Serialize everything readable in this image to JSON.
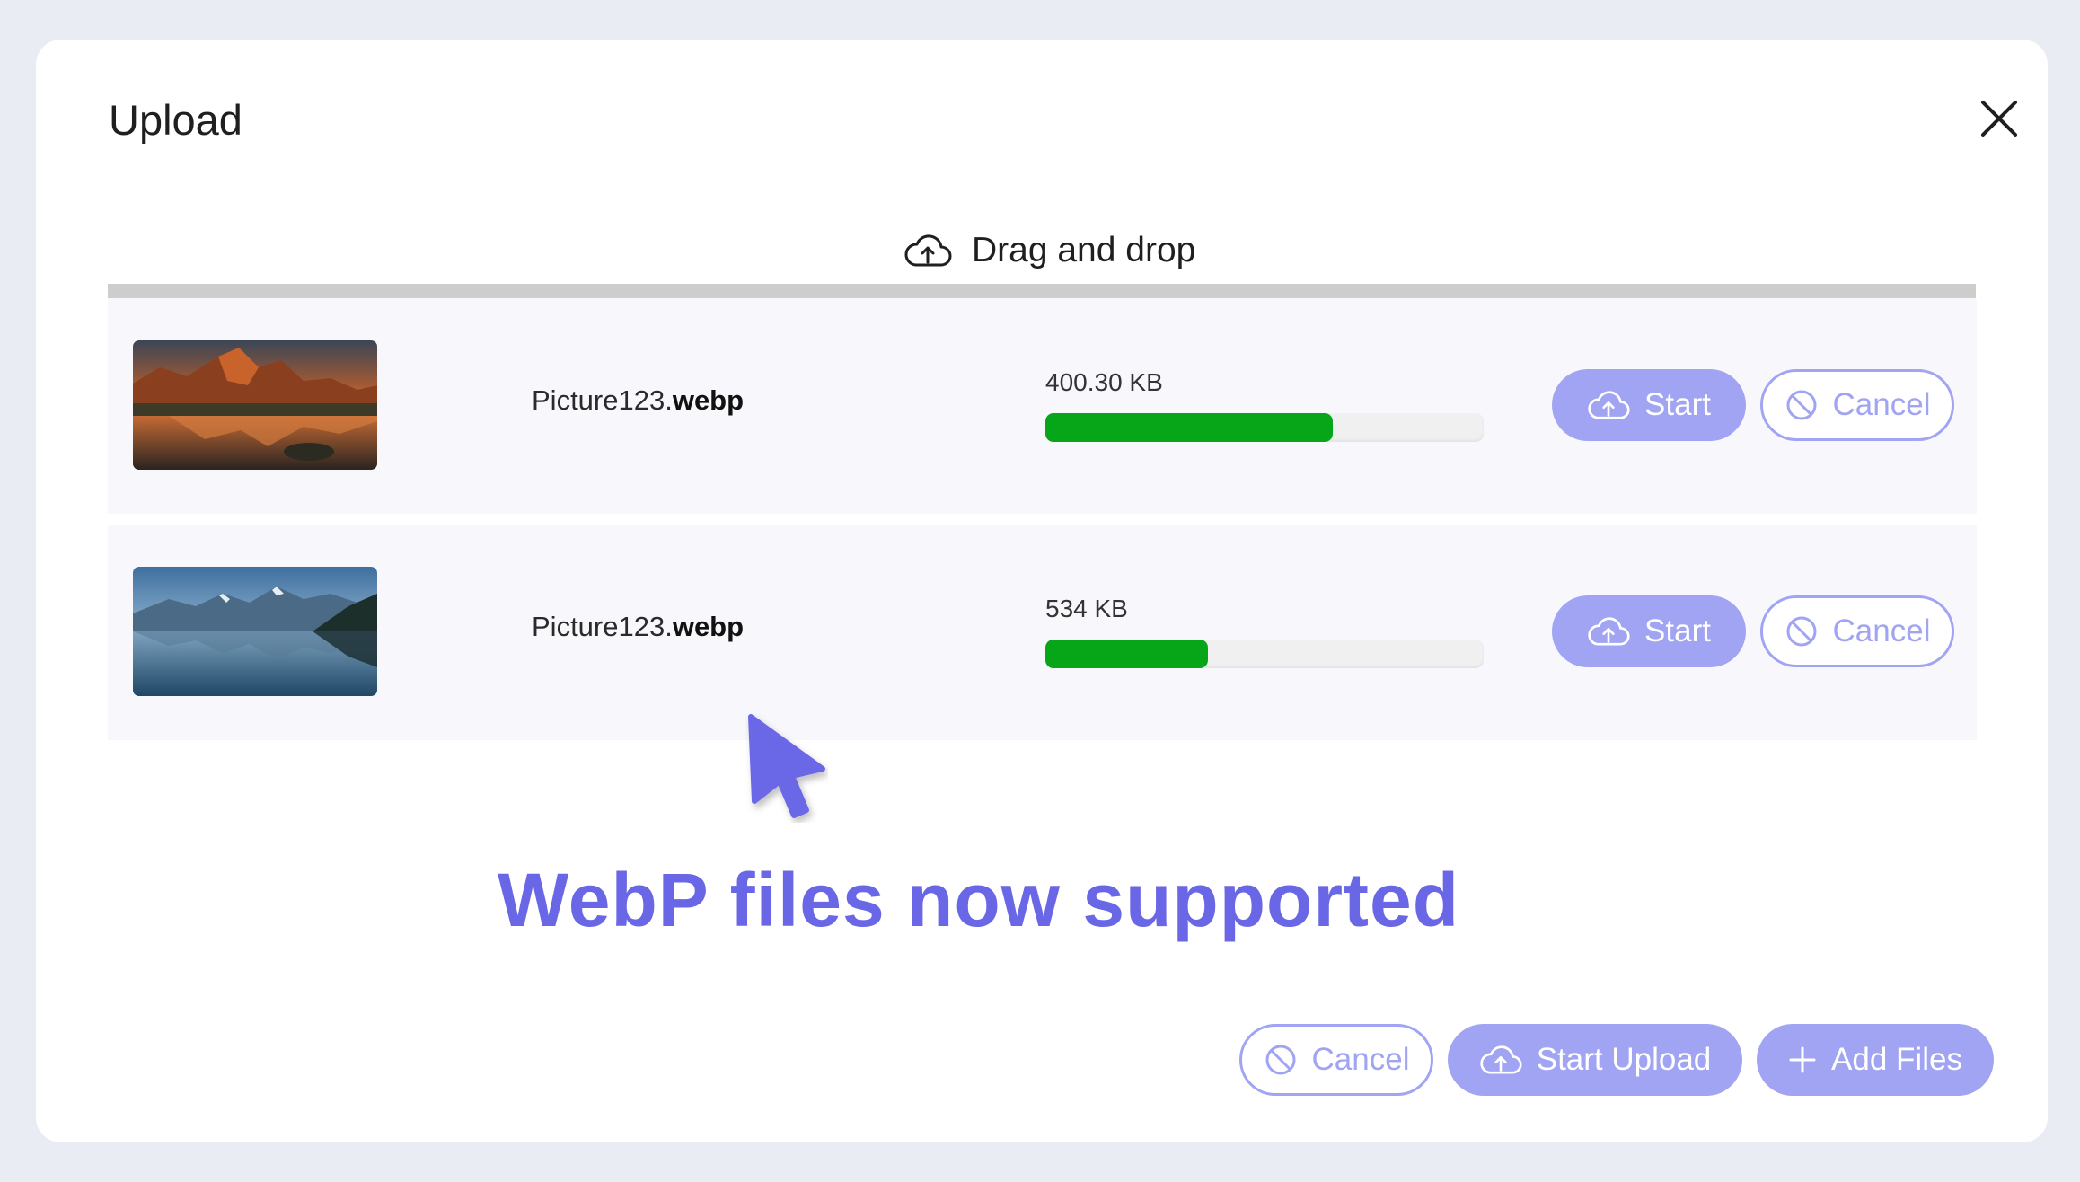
{
  "dialog": {
    "title": "Upload",
    "dropzone_label": "Drag and drop"
  },
  "files": [
    {
      "name": "Picture123.",
      "ext": "webp",
      "size": "400.30 KB",
      "progress_fraction": 0.655,
      "thumbnail": "mountain-sunset-lake",
      "start_label": "Start",
      "cancel_label": "Cancel"
    },
    {
      "name": "Picture123.",
      "ext": "webp",
      "size": "534 KB",
      "progress_fraction": 0.37,
      "thumbnail": "blue-mountain-lake",
      "start_label": "Start",
      "cancel_label": "Cancel"
    }
  ],
  "announcement": "WebP files now supported",
  "footer": {
    "cancel_label": "Cancel",
    "start_upload_label": "Start Upload",
    "add_files_label": "Add Files"
  },
  "colors": {
    "accent": "#a1a4f2",
    "announcement": "#6a67e6",
    "progress": "#07a619",
    "cursor": "#6a67e6"
  },
  "icons": {
    "close": "close-icon",
    "upload": "cloud-upload-icon",
    "cancel": "cancel-icon",
    "add": "plus-icon",
    "cursor": "cursor-pointer-icon"
  }
}
